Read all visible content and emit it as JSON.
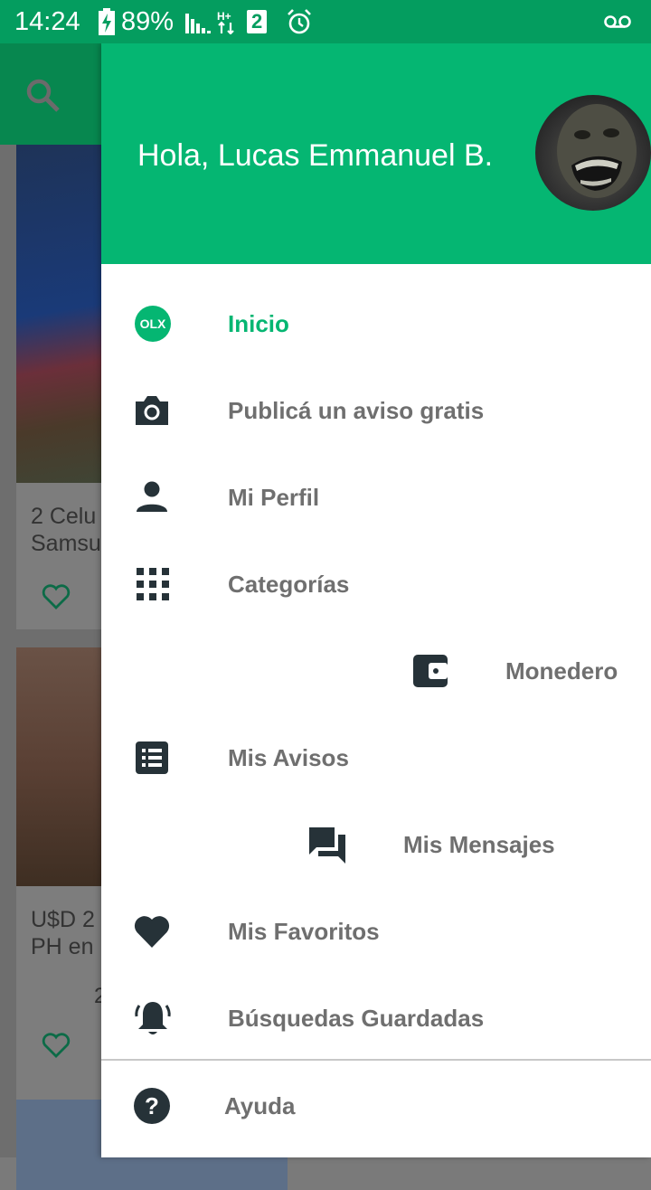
{
  "status_bar": {
    "time": "14:24",
    "battery": "89%",
    "sim_number": "2"
  },
  "background": {
    "cards": [
      {
        "title": "2 Celu\nSamsu"
      },
      {
        "title": "U$D 2\nPH en",
        "extra": "2"
      }
    ]
  },
  "drawer": {
    "greeting": "Hola, Lucas Emmanuel B.",
    "items": [
      {
        "label": "Inicio",
        "icon": "olx-logo-icon"
      },
      {
        "label": "Publicá un aviso gratis",
        "icon": "camera-icon"
      },
      {
        "label": "Mi Perfil",
        "icon": "person-icon"
      },
      {
        "label": "Categorías",
        "icon": "grid-icon"
      },
      {
        "label": "Monedero",
        "icon": "wallet-icon"
      },
      {
        "label": "Mis Avisos",
        "icon": "list-icon"
      },
      {
        "label": "Mis Mensajes",
        "icon": "chat-icon"
      },
      {
        "label": "Mis Favoritos",
        "icon": "heart-icon"
      },
      {
        "label": "Búsquedas Guardadas",
        "icon": "bell-icon"
      },
      {
        "label": "Ayuda",
        "icon": "help-icon"
      }
    ]
  },
  "colors": {
    "accent": "#05b672",
    "status_bar": "#049d5f",
    "icon": "#263238",
    "label": "#6f6f6f"
  }
}
